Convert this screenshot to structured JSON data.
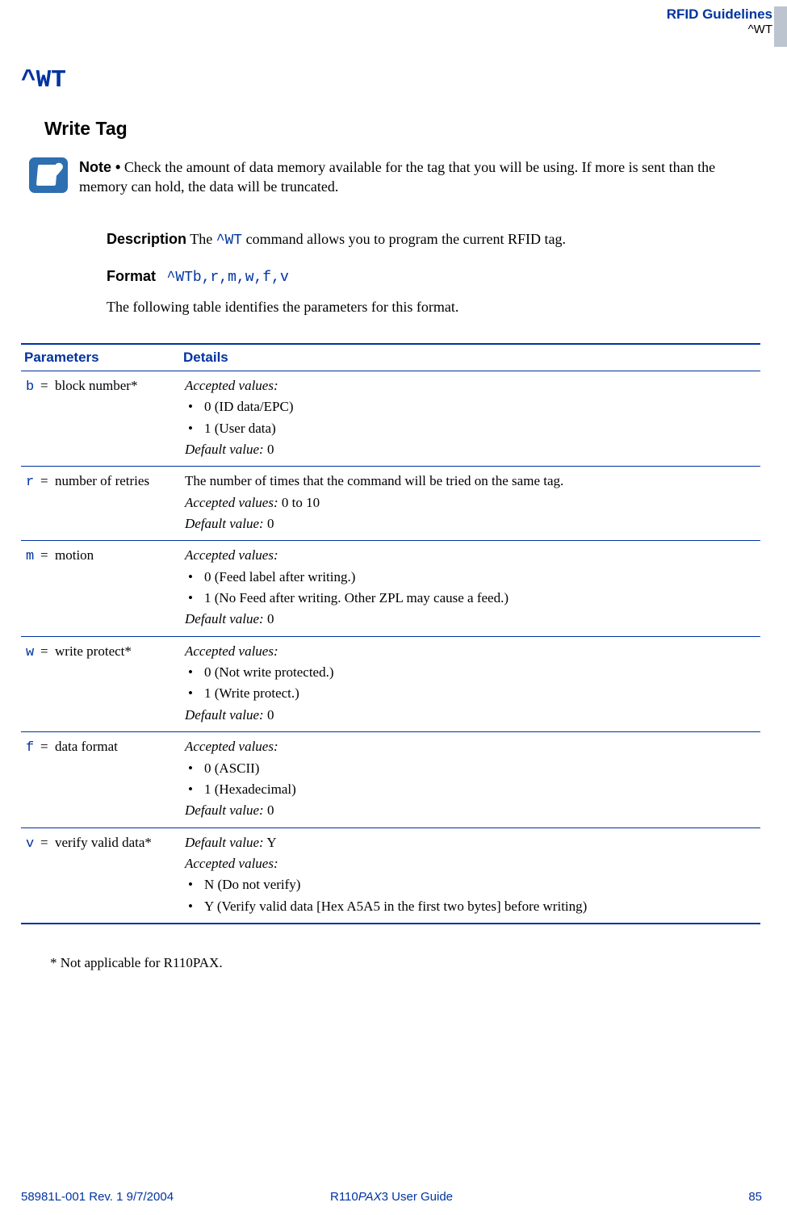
{
  "header": {
    "title": "RFID Guidelines",
    "sub": "^WT"
  },
  "cmd_heading": "^WT",
  "section_title": "Write Tag",
  "note": {
    "label": "Note •",
    "text": "Check the amount of data memory available for the tag that you will be using. If more is sent than the memory can hold, the data will be truncated."
  },
  "description": {
    "label": "Description",
    "pre": "  The ",
    "cmd": "^WT",
    "post": " command allows you to program the current RFID tag."
  },
  "format": {
    "label": "Format",
    "value": "^WTb,r,m,w,f,v"
  },
  "table_lead": "The following table identifies the parameters for this format.",
  "table": {
    "head_params": "Parameters",
    "head_details": "Details",
    "rows": [
      {
        "sym": "b",
        "name": "block number*",
        "details": {
          "accepted_label": "Accepted values:",
          "bullets": [
            "0 (ID data/EPC)",
            "1 (User data)"
          ],
          "default_label": "Default value:",
          "default_val": " 0"
        }
      },
      {
        "sym": "r",
        "name": "number of retries",
        "details": {
          "pre_text": "The number of times that the command will be tried on the same tag.",
          "accepted_label": "Accepted values:",
          "accepted_inline": " 0 to 10",
          "default_label": "Default value:",
          "default_val": " 0"
        }
      },
      {
        "sym": "m",
        "name": "motion",
        "details": {
          "accepted_label": "Accepted values:",
          "bullets": [
            "0 (Feed label after writing.)",
            "1 (No Feed after writing. Other ZPL may cause a feed.)"
          ],
          "default_label": "Default value:",
          "default_val": " 0"
        }
      },
      {
        "sym": "w",
        "name": "write protect*",
        "details": {
          "accepted_label": "Accepted values:",
          "bullets": [
            "0 (Not write protected.)",
            "1 (Write protect.)"
          ],
          "default_label": "Default value:",
          "default_val": " 0"
        }
      },
      {
        "sym": "f",
        "name": "data format",
        "details": {
          "accepted_label": "Accepted values:",
          "bullets": [
            "0 (ASCII)",
            "1 (Hexadecimal)"
          ],
          "default_label": "Default value:",
          "default_val": " 0"
        }
      },
      {
        "sym": "v",
        "name": "verify valid data*",
        "details": {
          "default_label": "Default value:",
          "default_val": " Y",
          "accepted_label": "Accepted values:",
          "bullets": [
            "N (Do not verify)",
            "Y (Verify valid data [Hex A5A5 in the first two bytes] before writing)"
          ]
        }
      }
    ]
  },
  "footnote": "* Not applicable for R110PAX.",
  "footer": {
    "left": "58981L-001 Rev. 1    9/7/2004",
    "center_pre": "R110",
    "center_italic": "PAX",
    "center_post": "3 User Guide",
    "right": "85"
  }
}
